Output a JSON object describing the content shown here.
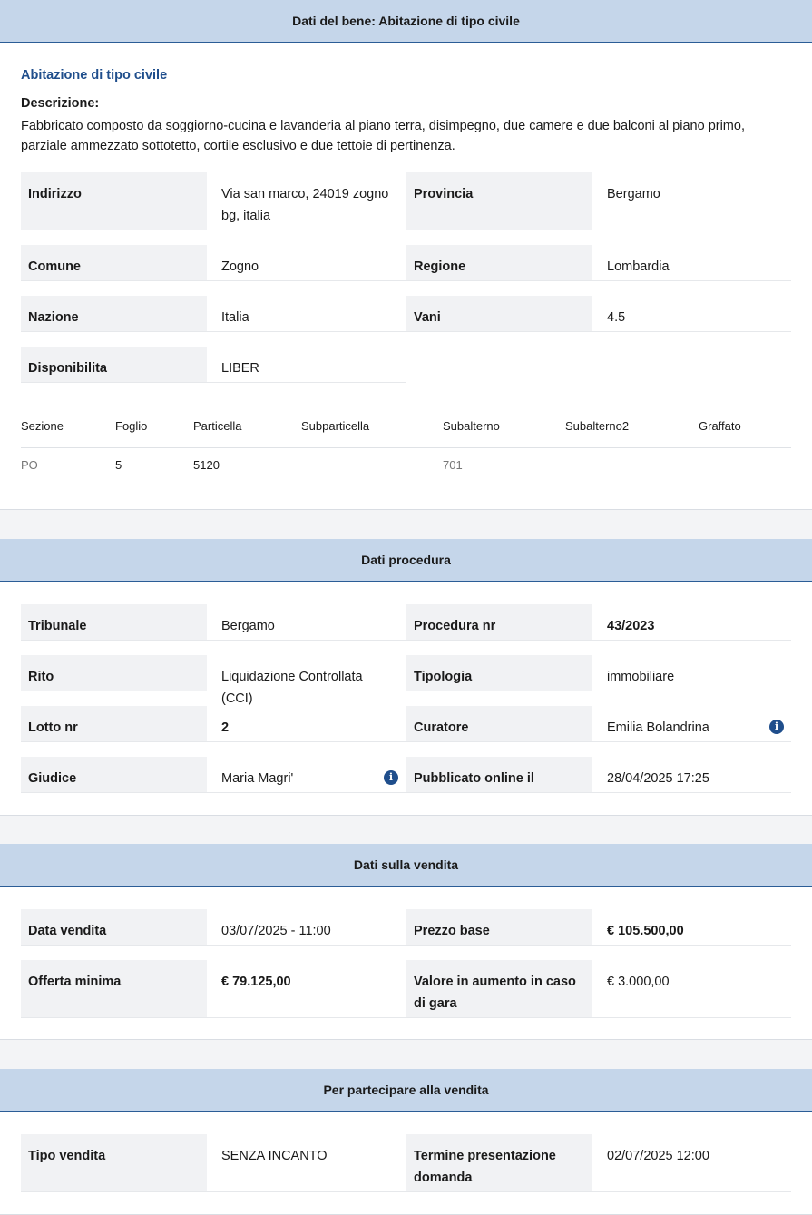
{
  "bene": {
    "header": "Dati del bene: Abitazione di tipo civile",
    "subtitle": "Abitazione di tipo civile",
    "desc_label": "Descrizione:",
    "desc_text": "Fabbricato composto da soggiorno-cucina e lavanderia al piano terra, disimpegno, due camere e due balconi al piano primo, parziale ammezzato sottotetto, cortile esclusivo e due tettoie di pertinenza.",
    "fields": {
      "indirizzo_k": "Indirizzo",
      "indirizzo_v": "Via san marco, 24019 zogno bg, italia",
      "provincia_k": "Provincia",
      "provincia_v": "Bergamo",
      "comune_k": "Comune",
      "comune_v": "Zogno",
      "regione_k": "Regione",
      "regione_v": "Lombardia",
      "nazione_k": "Nazione",
      "nazione_v": "Italia",
      "vani_k": "Vani",
      "vani_v": "4.5",
      "disp_k": "Disponibilita",
      "disp_v": "LIBER"
    },
    "catasto": {
      "headers": [
        "Sezione",
        "Foglio",
        "Particella",
        "Subparticella",
        "Subalterno",
        "Subalterno2",
        "Graffato"
      ],
      "values": [
        "PO",
        "5",
        "5120",
        "",
        "701",
        "",
        ""
      ]
    }
  },
  "procedura": {
    "header": "Dati procedura",
    "tribunale_k": "Tribunale",
    "tribunale_v": "Bergamo",
    "procedura_k": "Procedura nr",
    "procedura_v": "43/2023",
    "rito_k": "Rito",
    "rito_v": "Liquidazione Controllata (CCI)",
    "tipologia_k": "Tipologia",
    "tipologia_v": "immobiliare",
    "lotto_k": "Lotto nr",
    "lotto_v": "2",
    "curatore_k": "Curatore",
    "curatore_v": "Emilia Bolandrina",
    "giudice_k": "Giudice",
    "giudice_v": "Maria Magri'",
    "pubblicato_k": "Pubblicato online il",
    "pubblicato_v": "28/04/2025 17:25",
    "info_glyph": "i"
  },
  "vendita": {
    "header": "Dati sulla vendita",
    "data_k": "Data vendita",
    "data_v": "03/07/2025 - 11:00",
    "prezzo_k": "Prezzo base",
    "prezzo_v": "€ 105.500,00",
    "offerta_k": "Offerta minima",
    "offerta_v": "€ 79.125,00",
    "aumento_k": "Valore in aumento in caso di gara",
    "aumento_v": "€ 3.000,00"
  },
  "partecipare": {
    "header": "Per partecipare alla vendita",
    "tipo_k": "Tipo vendita",
    "tipo_v": "SENZA INCANTO",
    "termine_k": "Termine presentazione domanda",
    "termine_v": "02/07/2025 12:00"
  }
}
